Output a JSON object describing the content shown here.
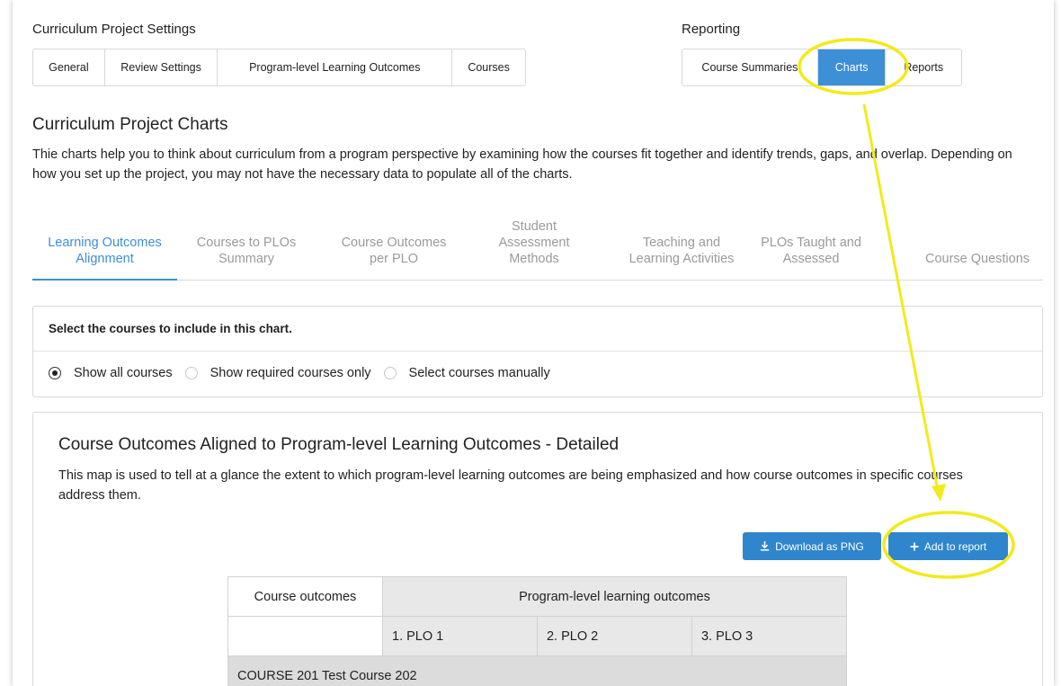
{
  "settings": {
    "label": "Curriculum Project Settings",
    "tabs": [
      {
        "label": "General"
      },
      {
        "label": "Review Settings"
      },
      {
        "label": "Program-level Learning Outcomes"
      },
      {
        "label": "Courses"
      }
    ]
  },
  "reporting": {
    "label": "Reporting",
    "tabs": [
      {
        "label": "Course Summaries",
        "active": false
      },
      {
        "label": "Charts",
        "active": true
      },
      {
        "label": "Reports",
        "active": false
      }
    ]
  },
  "page": {
    "title": "Curriculum Project Charts",
    "description": "Thie charts help you to think about curriculum from a program perspective by examining how the courses fit together and identify trends, gaps, and overlap. Depending on how you set up the project, you may not have the necessary data to populate all of the charts."
  },
  "chart_tabs": [
    {
      "label": "Learning Outcomes Alignment",
      "active": true
    },
    {
      "label": "Courses to PLOs Summary",
      "active": false
    },
    {
      "label": "Course Outcomes per PLO",
      "active": false
    },
    {
      "label": "Student Assessment Methods",
      "active": false
    },
    {
      "label": "Teaching and Learning Activities",
      "active": false
    },
    {
      "label": "PLOs Taught and Assessed",
      "active": false
    },
    {
      "label": "Course Questions",
      "active": false
    }
  ],
  "course_select": {
    "heading": "Select the courses to include in this chart.",
    "options": [
      {
        "label": "Show all courses",
        "checked": true
      },
      {
        "label": "Show required courses only",
        "checked": false
      },
      {
        "label": "Select courses manually",
        "checked": false
      }
    ]
  },
  "chart": {
    "title": "Course Outcomes Aligned to Program-level Learning Outcomes - Detailed",
    "description": "This map is used to tell at a glance the extent to which program-level learning outcomes are being emphasized and how course outcomes in specific courses address them.",
    "download_label": "Download as PNG",
    "add_label": "Add to report",
    "table": {
      "col_course_outcomes": "Course outcomes",
      "col_plo_group": "Program-level learning outcomes",
      "plos": [
        "1. PLO 1",
        "2. PLO 2",
        "3. PLO 3"
      ],
      "course_row": "COURSE 201 Test Course 202"
    }
  },
  "colors": {
    "accent": "#3d8fd6",
    "button": "#2f86cc",
    "annotation": "#f2ea1c"
  },
  "icons": {
    "download": "download-icon",
    "add": "plus-icon"
  }
}
